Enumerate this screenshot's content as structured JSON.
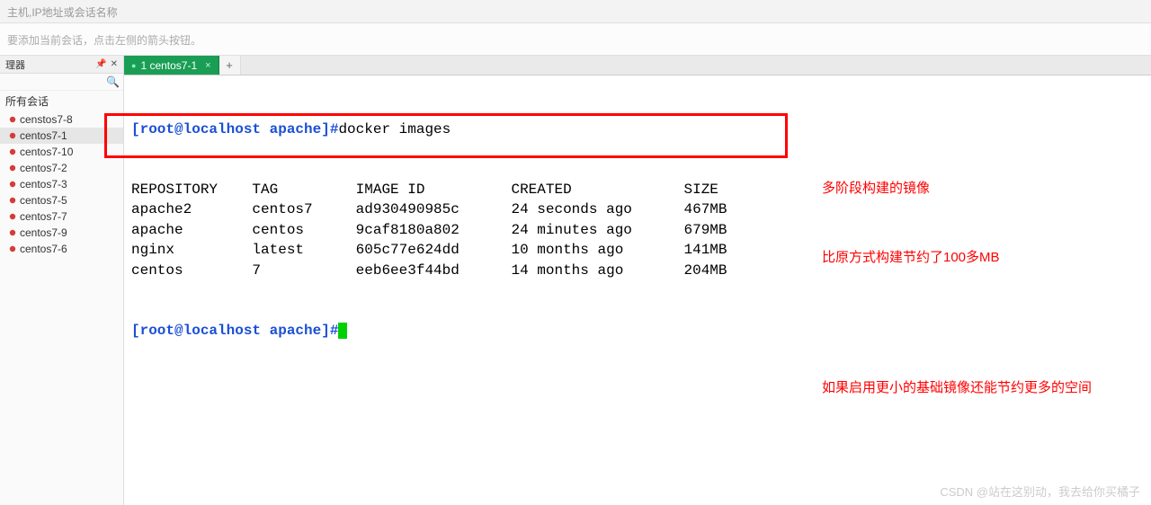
{
  "top_placeholder": "主机,IP地址或会话名称",
  "hint_text": "要添加当前会话，点击左侧的箭头按钮。",
  "sidebar": {
    "header": "理器",
    "group_label": "所有会话",
    "items": [
      {
        "label": "censtos7-8",
        "selected": false
      },
      {
        "label": "centos7-1",
        "selected": true
      },
      {
        "label": "centos7-10",
        "selected": false
      },
      {
        "label": "centos7-2",
        "selected": false
      },
      {
        "label": "centos7-3",
        "selected": false
      },
      {
        "label": "centos7-5",
        "selected": false
      },
      {
        "label": "centos7-7",
        "selected": false
      },
      {
        "label": "centos7-9",
        "selected": false
      },
      {
        "label": "centos7-6",
        "selected": false
      }
    ]
  },
  "tab": {
    "label": "1 centos7-1"
  },
  "terminal": {
    "prompt": "[root@localhost apache]#",
    "command": "docker images",
    "header": {
      "repository": "REPOSITORY",
      "tag": "TAG",
      "image_id": "IMAGE ID",
      "created": "CREATED",
      "size": "SIZE"
    },
    "rows": [
      {
        "repository": "apache2",
        "tag": "centos7",
        "image_id": "ad930490985c",
        "created": "24 seconds ago",
        "size": "467MB"
      },
      {
        "repository": "apache",
        "tag": "centos",
        "image_id": "9caf8180a802",
        "created": "24 minutes ago",
        "size": "679MB"
      },
      {
        "repository": "nginx",
        "tag": "latest",
        "image_id": "605c77e624dd",
        "created": "10 months ago",
        "size": "141MB"
      },
      {
        "repository": "centos",
        "tag": "7",
        "image_id": "eeb6ee3f44bd",
        "created": "14 months ago",
        "size": "204MB"
      }
    ]
  },
  "annotations": {
    "line1": "多阶段构建的镜像",
    "line2": "比原方式构建节约了100多MB",
    "line3": "如果启用更小的基础镜像还能节约更多的空间"
  },
  "watermark": "CSDN @站在这别动，我去给你买橘子"
}
